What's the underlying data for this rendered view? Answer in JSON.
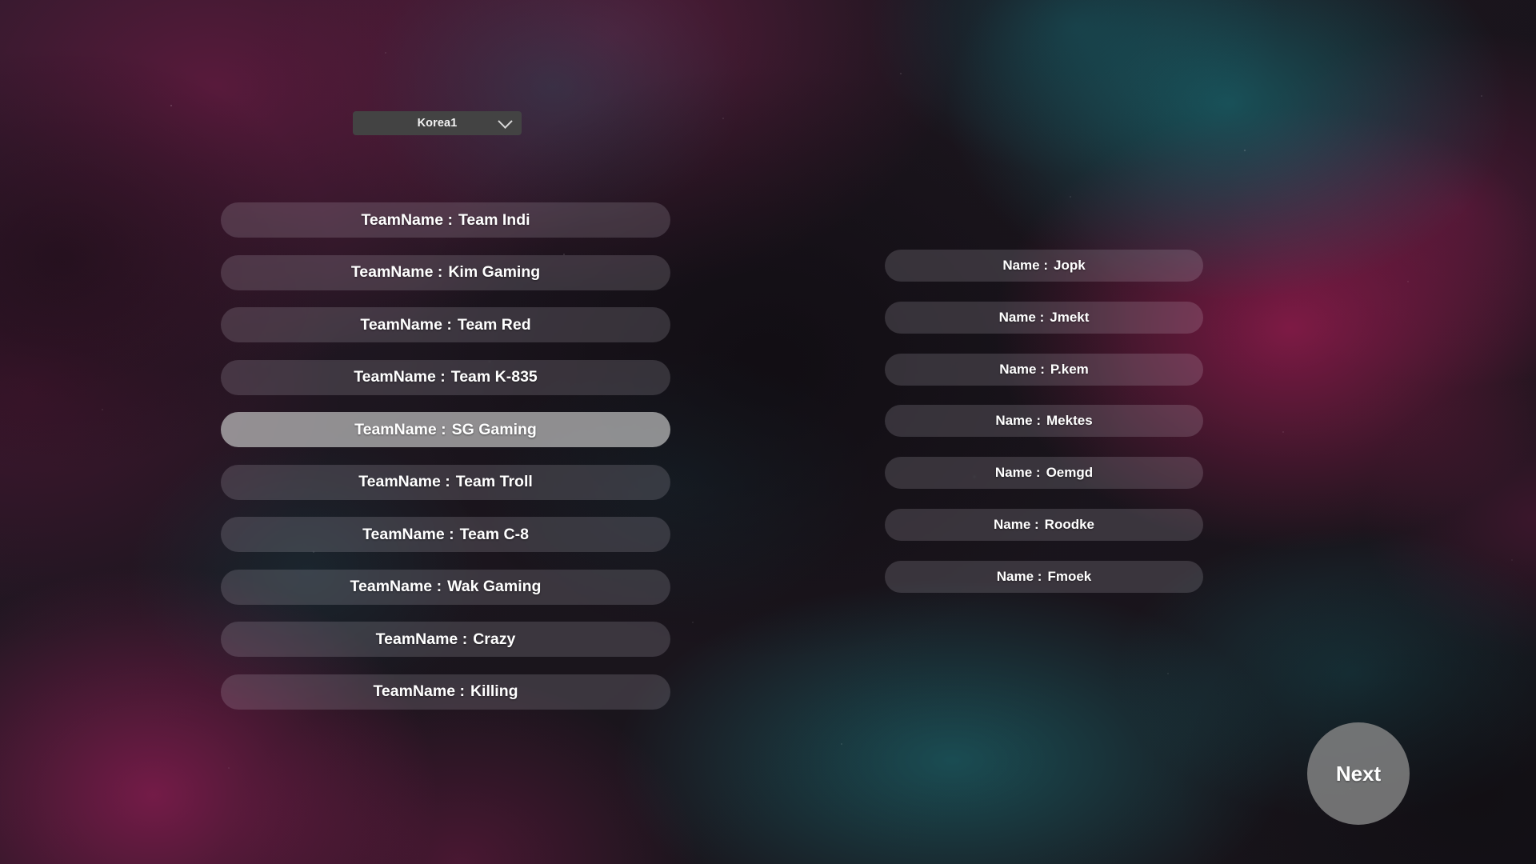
{
  "screen": {
    "name": "team-and-player-selection",
    "background_colors": {
      "base": "#1d1620",
      "nebula_magenta": "#a81c56",
      "nebula_crimson": "#961e58",
      "nebula_teal": "#187a80",
      "dark_void": "#0a080c"
    }
  },
  "region_dropdown": {
    "selected": "Korea1",
    "chevron_icon": "chevron-down-icon",
    "background_color": "#434343"
  },
  "team_list": {
    "label_prefix": "TeamName :",
    "selected_index": 4,
    "selected_background_color": "#bebebe",
    "row_background_color": "#e2deea",
    "items": [
      {
        "name": "Team Indi",
        "selected": false
      },
      {
        "name": "Kim Gaming",
        "selected": false
      },
      {
        "name": "Team Red",
        "selected": false
      },
      {
        "name": "Team K-835",
        "selected": false
      },
      {
        "name": "SG Gaming",
        "selected": true
      },
      {
        "name": "Team Troll",
        "selected": false
      },
      {
        "name": "Team C-8",
        "selected": false
      },
      {
        "name": "Wak Gaming",
        "selected": false
      },
      {
        "name": "Crazy",
        "selected": false
      },
      {
        "name": "Killing",
        "selected": false
      }
    ]
  },
  "player_list": {
    "label_prefix": "Name :",
    "items": [
      {
        "name": "Jopk"
      },
      {
        "name": "Jmekt"
      },
      {
        "name": "P.kem"
      },
      {
        "name": "Mektes"
      },
      {
        "name": "Oemgd"
      },
      {
        "name": "Roodke"
      },
      {
        "name": "Fmoek"
      }
    ]
  },
  "next_button": {
    "label": "Next",
    "background_color": "#868686"
  }
}
